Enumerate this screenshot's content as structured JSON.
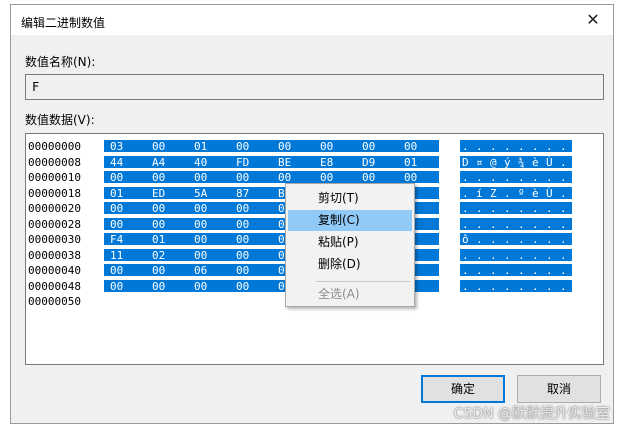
{
  "dialog": {
    "title": "编辑二进制数值",
    "close_glyph": "✕",
    "value_name_label": "数值名称(N):",
    "value_name": "F",
    "value_data_label": "数值数据(V):"
  },
  "hex": {
    "rows": [
      {
        "addr": "00000000",
        "bytes": [
          "03",
          "00",
          "01",
          "00",
          "00",
          "00",
          "00",
          "00"
        ],
        "ascii": [
          ".",
          ".",
          ".",
          ".",
          ".",
          ".",
          ".",
          "."
        ]
      },
      {
        "addr": "00000008",
        "bytes": [
          "44",
          "A4",
          "40",
          "FD",
          "BE",
          "E8",
          "D9",
          "01"
        ],
        "ascii": [
          "D",
          "¤",
          "@",
          "ý",
          "¾",
          "è",
          "Ù",
          "."
        ]
      },
      {
        "addr": "00000010",
        "bytes": [
          "00",
          "00",
          "00",
          "00",
          "00",
          "00",
          "00",
          "00"
        ],
        "ascii": [
          ".",
          ".",
          ".",
          ".",
          ".",
          ".",
          ".",
          "."
        ]
      },
      {
        "addr": "00000018",
        "bytes": [
          "01",
          "ED",
          "5A",
          "87",
          "B",
          "",
          "",
          ""
        ],
        "ascii": [
          ".",
          "í",
          "Z",
          ".",
          "º",
          "è",
          "Ù",
          "."
        ]
      },
      {
        "addr": "00000020",
        "bytes": [
          "00",
          "00",
          "00",
          "00",
          "0",
          "",
          "",
          "0"
        ],
        "ascii": [
          ".",
          ".",
          ".",
          ".",
          ".",
          ".",
          ".",
          "."
        ]
      },
      {
        "addr": "00000028",
        "bytes": [
          "00",
          "00",
          "00",
          "00",
          "0",
          "",
          "",
          "0"
        ],
        "ascii": [
          ".",
          ".",
          ".",
          ".",
          ".",
          ".",
          ".",
          "."
        ]
      },
      {
        "addr": "00000030",
        "bytes": [
          "F4",
          "01",
          "00",
          "00",
          "0",
          "",
          "",
          "0"
        ],
        "ascii": [
          "ô",
          ".",
          ".",
          ".",
          ".",
          ".",
          ".",
          "."
        ]
      },
      {
        "addr": "00000038",
        "bytes": [
          "11",
          "02",
          "00",
          "00",
          "0",
          "",
          "",
          "0"
        ],
        "ascii": [
          ".",
          ".",
          ".",
          ".",
          ".",
          ".",
          ".",
          "."
        ]
      },
      {
        "addr": "00000040",
        "bytes": [
          "00",
          "00",
          "06",
          "00",
          "0",
          "",
          "",
          "0"
        ],
        "ascii": [
          ".",
          ".",
          ".",
          ".",
          ".",
          ".",
          ".",
          "."
        ]
      },
      {
        "addr": "00000048",
        "bytes": [
          "00",
          "00",
          "00",
          "00",
          "0",
          "",
          "",
          "0"
        ],
        "ascii": [
          ".",
          ".",
          ".",
          ".",
          ".",
          ".",
          ".",
          "."
        ]
      },
      {
        "addr": "00000050",
        "bytes": [],
        "ascii": []
      }
    ]
  },
  "context_menu": {
    "items": [
      {
        "label": "剪切(T)",
        "state": "normal"
      },
      {
        "label": "复制(C)",
        "state": "highlighted"
      },
      {
        "label": "粘贴(P)",
        "state": "normal"
      },
      {
        "label": "删除(D)",
        "state": "normal"
      },
      {
        "label": "全选(A)",
        "state": "disabled"
      }
    ]
  },
  "buttons": {
    "ok": "确定",
    "cancel": "取消"
  },
  "watermark": "CSDN @默默提升实验室",
  "colors": {
    "selection": "#0078d7",
    "menu_highlight": "#91c9f7",
    "dialog_bg": "#f0f0f0"
  }
}
